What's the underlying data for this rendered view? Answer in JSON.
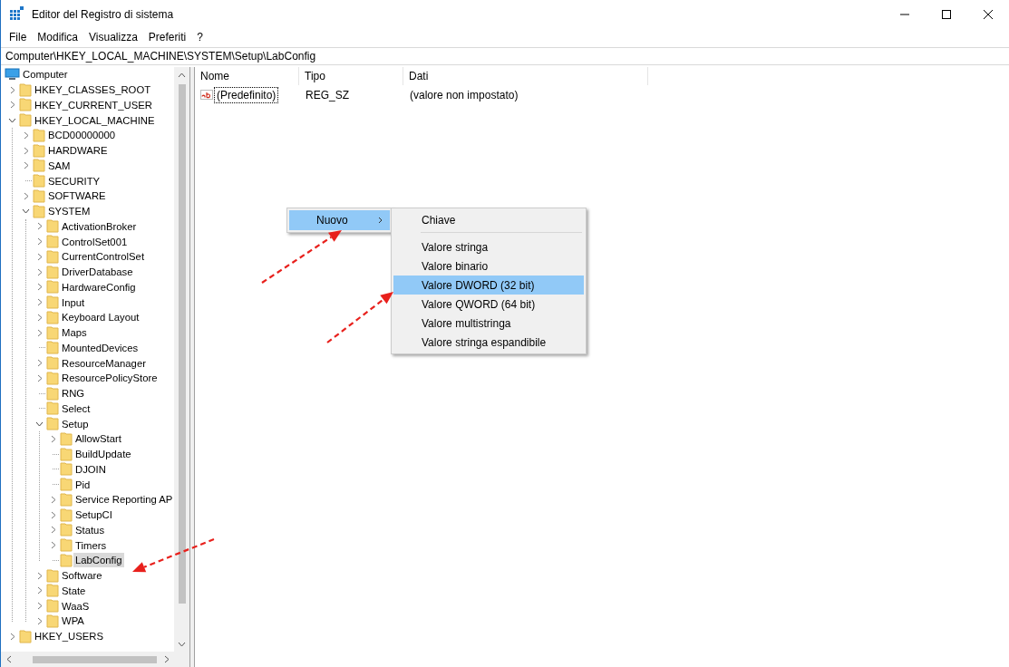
{
  "window": {
    "title": "Editor del Registro di sistema"
  },
  "menu": [
    "File",
    "Modifica",
    "Visualizza",
    "Preferiti",
    "?"
  ],
  "address": "Computer\\HKEY_LOCAL_MACHINE\\SYSTEM\\Setup\\LabConfig",
  "tree": [
    {
      "label": "Computer",
      "kind": "computer",
      "selected": false,
      "children": [
        {
          "label": "HKEY_CLASSES_ROOT",
          "kind": "folder",
          "expanded": false,
          "selected": false
        },
        {
          "label": "HKEY_CURRENT_USER",
          "kind": "folder",
          "expanded": false,
          "selected": false
        },
        {
          "label": "HKEY_LOCAL_MACHINE",
          "kind": "folder",
          "expanded": true,
          "selected": false,
          "children": [
            {
              "label": "BCD00000000",
              "kind": "folder",
              "expanded": false,
              "selected": false
            },
            {
              "label": "HARDWARE",
              "kind": "folder",
              "expanded": false,
              "selected": false
            },
            {
              "label": "SAM",
              "kind": "folder",
              "expanded": false,
              "selected": false
            },
            {
              "label": "SECURITY",
              "kind": "folder",
              "selected": false
            },
            {
              "label": "SOFTWARE",
              "kind": "folder",
              "expanded": false,
              "selected": false
            },
            {
              "label": "SYSTEM",
              "kind": "folder",
              "expanded": true,
              "selected": false,
              "children": [
                {
                  "label": "ActivationBroker",
                  "kind": "folder",
                  "expanded": false,
                  "selected": false
                },
                {
                  "label": "ControlSet001",
                  "kind": "folder",
                  "expanded": false,
                  "selected": false
                },
                {
                  "label": "CurrentControlSet",
                  "kind": "folder",
                  "expanded": false,
                  "selected": false
                },
                {
                  "label": "DriverDatabase",
                  "kind": "folder",
                  "expanded": false,
                  "selected": false
                },
                {
                  "label": "HardwareConfig",
                  "kind": "folder",
                  "expanded": false,
                  "selected": false
                },
                {
                  "label": "Input",
                  "kind": "folder",
                  "expanded": false,
                  "selected": false
                },
                {
                  "label": "Keyboard Layout",
                  "kind": "folder",
                  "expanded": false,
                  "selected": false
                },
                {
                  "label": "Maps",
                  "kind": "folder",
                  "expanded": false,
                  "selected": false
                },
                {
                  "label": "MountedDevices",
                  "kind": "folder",
                  "selected": false
                },
                {
                  "label": "ResourceManager",
                  "kind": "folder",
                  "expanded": false,
                  "selected": false
                },
                {
                  "label": "ResourcePolicyStore",
                  "kind": "folder",
                  "expanded": false,
                  "selected": false
                },
                {
                  "label": "RNG",
                  "kind": "folder",
                  "selected": false
                },
                {
                  "label": "Select",
                  "kind": "folder",
                  "selected": false
                },
                {
                  "label": "Setup",
                  "kind": "folder",
                  "expanded": true,
                  "selected": false,
                  "children": [
                    {
                      "label": "AllowStart",
                      "kind": "folder",
                      "expanded": false,
                      "selected": false
                    },
                    {
                      "label": "BuildUpdate",
                      "kind": "folder",
                      "selected": false
                    },
                    {
                      "label": "DJOIN",
                      "kind": "folder",
                      "selected": false
                    },
                    {
                      "label": "Pid",
                      "kind": "folder",
                      "selected": false
                    },
                    {
                      "label": "Service Reporting AP",
                      "kind": "folder",
                      "expanded": false,
                      "selected": false
                    },
                    {
                      "label": "SetupCI",
                      "kind": "folder",
                      "expanded": false,
                      "selected": false
                    },
                    {
                      "label": "Status",
                      "kind": "folder",
                      "expanded": false,
                      "selected": false
                    },
                    {
                      "label": "Timers",
                      "kind": "folder",
                      "expanded": false,
                      "selected": false
                    },
                    {
                      "label": "LabConfig",
                      "kind": "folder",
                      "selected": true
                    }
                  ]
                },
                {
                  "label": "Software",
                  "kind": "folder",
                  "expanded": false,
                  "selected": false
                },
                {
                  "label": "State",
                  "kind": "folder",
                  "expanded": false,
                  "selected": false
                },
                {
                  "label": "WaaS",
                  "kind": "folder",
                  "expanded": false,
                  "selected": false
                },
                {
                  "label": "WPA",
                  "kind": "folder",
                  "expanded": false,
                  "selected": false
                }
              ]
            }
          ]
        },
        {
          "label": "HKEY_USERS",
          "kind": "folder",
          "expanded": false,
          "selected": false
        }
      ]
    }
  ],
  "list": {
    "columns": [
      "Nome",
      "Tipo",
      "Dati"
    ],
    "rows": [
      {
        "name": "(Predefinito)",
        "type": "REG_SZ",
        "data": "(valore non impostato)",
        "focused": true
      }
    ]
  },
  "context_menu": {
    "items": [
      {
        "label": "Nuovo",
        "selected": true
      }
    ],
    "submenu": [
      {
        "kind": "item",
        "label": "Chiave",
        "selected": false
      },
      {
        "kind": "separator"
      },
      {
        "kind": "item",
        "label": "Valore stringa",
        "selected": false
      },
      {
        "kind": "item",
        "label": "Valore binario",
        "selected": false
      },
      {
        "kind": "item",
        "label": "Valore DWORD (32 bit)",
        "selected": true
      },
      {
        "kind": "item",
        "label": "Valore QWORD (64 bit)",
        "selected": false
      },
      {
        "kind": "item",
        "label": "Valore multistringa",
        "selected": false
      },
      {
        "kind": "item",
        "label": "Valore stringa espandibile",
        "selected": false
      }
    ]
  }
}
